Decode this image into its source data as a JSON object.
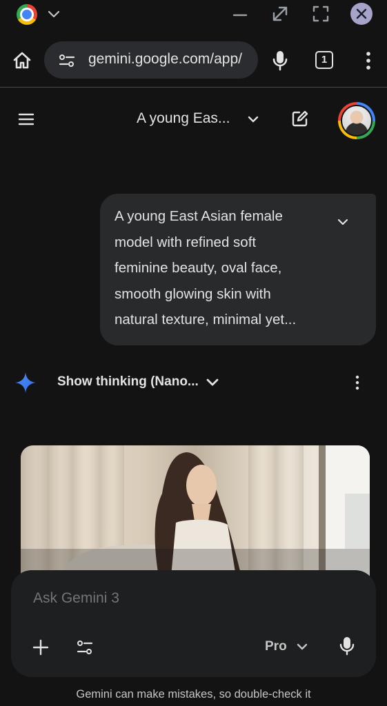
{
  "browser": {
    "url": "gemini.google.com/app/",
    "tab_count": "1"
  },
  "app_header": {
    "chat_title": "A young Eas..."
  },
  "conversation": {
    "user_prompt_lines": [
      "A young East Asian female",
      "model with refined soft",
      "feminine beauty, oval face,",
      "smooth glowing skin with",
      "natural texture, minimal yet..."
    ],
    "response_header": "Show thinking (Nano..."
  },
  "composer": {
    "placeholder": "Ask Gemini 3",
    "model": "Pro"
  },
  "footer": {
    "disclaimer": "Gemini can make mistakes, so double-check it"
  },
  "colors": {
    "background": "#131314",
    "surface": "#1e1f20",
    "bubble": "#282a2c",
    "text": "#e3e3e3",
    "gemini_blue": "#4285f4"
  }
}
